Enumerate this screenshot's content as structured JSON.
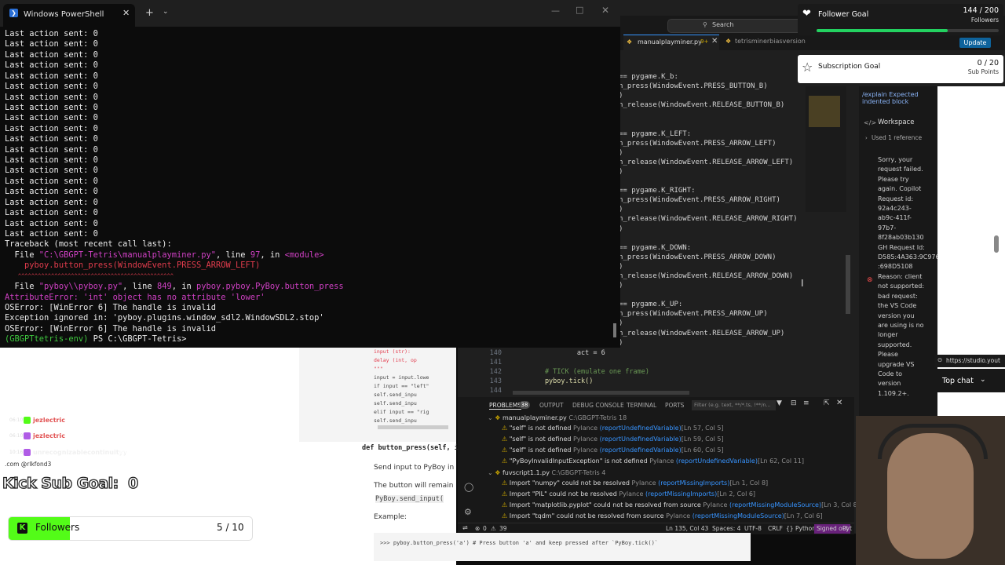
{
  "powershell": {
    "tab_title": "Windows PowerShell",
    "lines": [
      "Last action sent: 0",
      "Last action sent: 0",
      "Last action sent: 0",
      "Last action sent: 0",
      "Last action sent: 0",
      "Last action sent: 0",
      "Last action sent: 0",
      "Last action sent: 0",
      "Last action sent: 0",
      "Last action sent: 0",
      "Last action sent: 0",
      "Last action sent: 0",
      "Last action sent: 0",
      "Last action sent: 0",
      "Last action sent: 0",
      "Last action sent: 0",
      "Last action sent: 0",
      "Last action sent: 0",
      "Last action sent: 0",
      "Last action sent: 0"
    ],
    "traceback": "Traceback (most recent call last):",
    "file1_prefix": "  File ",
    "file1_path": "\"C:\\GBGPT-Tetris\\manualplayminer.py\"",
    "file1_mid": ", line ",
    "file1_line": "97",
    "file1_in": ", in ",
    "file1_mod": "<module>",
    "call1": "    pyboy.button_press(WindowEvent.PRESS_ARROW_LEFT)",
    "carets": "    ^^^^^^^^^^^^^^^^^^^^^^^^^^^^^^^^^^^^^^^^^^^^^^^",
    "file2_prefix": "  File ",
    "file2_path": "\"pyboy\\\\pyboy.py\"",
    "file2_mid": ", line ",
    "file2_line": "849",
    "file2_in": ", in ",
    "file2_func": "pyboy.pyboy.PyBoy.button_press",
    "attr_error": "AttributeError: 'int' object has no attribute 'lower'",
    "os1": "OSError: [WinError 6] The handle is invalid",
    "exc": "Exception ignored in: 'pyboy.plugins.window_sdl2.WindowSDL2.stop'",
    "os2": "OSError: [WinError 6] The handle is invalid",
    "prompt_env": "(GBGPTtetris-env)",
    "prompt_path": " PS C:\\GBGPT-Tetris>"
  },
  "vscode": {
    "search": "Search",
    "tab1": "manualplayminer.py",
    "tab1_badge": "9+",
    "tab2": "tetrisminerbiasversion",
    "update": "Update",
    "code": [
      "== pygame.K_b:",
      "n_press(WindowEvent.PRESS_BUTTON_B)",
      ")",
      "n_release(WindowEvent.RELEASE_BUTTON_B)",
      "",
      "",
      "== pygame.K_LEFT:",
      "n_press(WindowEvent.PRESS_ARROW_LEFT)",
      ")",
      "n_release(WindowEvent.RELEASE_ARROW_LEFT)",
      ")",
      "",
      "== pygame.K_RIGHT:",
      "n_press(WindowEvent.PRESS_ARROW_RIGHT)",
      ")",
      "n_release(WindowEvent.RELEASE_ARROW_RIGHT)",
      ")",
      "",
      "== pygame.K_DOWN:",
      "n_press(WindowEvent.PRESS_ARROW_DOWN)",
      ")",
      "n_release(WindowEvent.RELEASE_ARROW_DOWN)",
      ")",
      "",
      "== pygame.K_UP:",
      "n_press(WindowEvent.PRESS_ARROW_UP)",
      ")",
      "n_release(WindowEvent.RELEASE_ARROW_UP)",
      ")"
    ],
    "lower_code": [
      {
        "num": "140",
        "text": "                act = 6"
      },
      {
        "num": "141",
        "text": ""
      },
      {
        "num": "142",
        "text": "        # TICK (emulate one frame)"
      },
      {
        "num": "143",
        "text": "        pyboy.tick()"
      },
      {
        "num": "144",
        "text": ""
      }
    ],
    "copilot": {
      "explain": "/explain Expected indented block",
      "workspace": "Workspace",
      "used_ref": "Used 1 reference",
      "message": "Sorry, your request failed. Please try again. Copilot Request id: 92a4c243-ab9c-411f-97b7-8f28ab03b130 GH Request Id: D585:4A363:9C97631:81184E3 :698D5108 Reason: client not supported: bad request: the VS Code version you are using is no longer supported. Please upgrade VS Code to version 1.109.2+."
    },
    "panel_tabs": {
      "problems": "PROBLEMS",
      "problems_count": "38",
      "output": "OUTPUT",
      "debug": "DEBUG CONSOLE",
      "debug_count": "18",
      "terminal": "TERMINAL",
      "ports": "PORTS",
      "filter": "Filter (e.g. text, **/*.ts, !**/n..."
    },
    "problems": [
      {
        "text": "\"self\" is not defined",
        "src": "Pylance",
        "code": "(reportUndefinedVariable)",
        "loc": "[Ln 57, Col 5]"
      },
      {
        "text": "\"self\" is not defined",
        "src": "Pylance",
        "code": "(reportUndefinedVariable)",
        "loc": "[Ln 59, Col 5]"
      },
      {
        "text": "\"self\" is not defined",
        "src": "Pylance",
        "code": "(reportUndefinedVariable)",
        "loc": "[Ln 60, Col 5]"
      },
      {
        "text": "\"PyBoyInvalidInputException\" is not defined",
        "src": "Pylance",
        "code": "(reportUndefinedVariable)",
        "loc": "[Ln 62, Col 11]"
      }
    ],
    "file_group1": {
      "name": "manualplayminer.py",
      "path": "C:\\GBGPT-Tetris",
      "count": "18"
    },
    "file_group2": {
      "name": "fuvscript1.1.py",
      "path": "C:\\GBGPT-Tetris",
      "count": "4"
    },
    "problems2": [
      {
        "text": "Import \"numpy\" could not be resolved",
        "src": "Pylance",
        "code": "(reportMissingImports)",
        "loc": "[Ln 1, Col 8]"
      },
      {
        "text": "Import \"PIL\" could not be resolved",
        "src": "Pylance",
        "code": "(reportMissingImports)",
        "loc": "[Ln 2, Col 6]"
      },
      {
        "text": "Import \"matplotlib.pyplot\" could not be resolved from source",
        "src": "Pylance",
        "code": "(reportMissingModuleSource)",
        "loc": "[Ln 3, Col 8]"
      },
      {
        "text": "Import \"tqdm\" could not be resolved from source",
        "src": "Pylance",
        "code": "(reportMissingModuleSource)",
        "loc": "[Ln 7, Col 6]"
      }
    ],
    "statusbar": {
      "errors": "0",
      "warnings": "39",
      "position": "Ln 135, Col 43",
      "spaces": "Spaces: 4",
      "encoding": "UTF-8",
      "eol": "CRLF",
      "lang": "Python",
      "signed_out": "Signed out",
      "tail": "Pyt"
    }
  },
  "docs": {
    "snip1": "input (str):",
    "snip2": "delay (int, op",
    "snip3": "\"\"\"",
    "snip4": "input = input.lowe",
    "snip5": "if input == \"left\"",
    "snip6": "self.send_inpu",
    "snip7": "self.send_inpu",
    "snip8": "elif input == \"rig",
    "snip9": "self.send_inpu",
    "def_kw": "def",
    "def_sig": "button_press(self, i",
    "desc1": "Send input to PyBoy in",
    "desc2": "The button will remain",
    "desc3": "PyBoy.send_input(",
    "example": "Example:",
    "example_code": ">>> pyboy.button_press('a') # Press button 'a' and keep pressed after `PyBoy.tick()`"
  },
  "chat": [
    {
      "time": "06:10",
      "user": "jezlectric",
      "msg": "test"
    },
    {
      "time": "06:10",
      "user": "jezlectric",
      "msg": "test"
    },
    {
      "time": "10:16",
      "user": "unrecognizablecontinuityy",
      "msg": "viewers streamboo"
    }
  ],
  "chat_cont": ".com @rlkfond3",
  "kick_goal": {
    "label": "Kick Sub Goal:",
    "value": "0"
  },
  "followers_bar": {
    "label": "Followers",
    "value": "5 / 10",
    "fraction": 0.5
  },
  "follower_goal": {
    "label": "Follower Goal",
    "value": "144 / 200",
    "unit": "Followers",
    "fraction": 0.72
  },
  "sub_goal": {
    "label": "Subscription Goal",
    "value": "0 / 20",
    "unit": "Sub Points"
  },
  "stream": {
    "url": "https://studio.yout",
    "top_chat": "Top chat"
  },
  "colors": {
    "accent": "#3794ff",
    "kick_green": "#53fc18",
    "follower_green": "#23d160"
  }
}
